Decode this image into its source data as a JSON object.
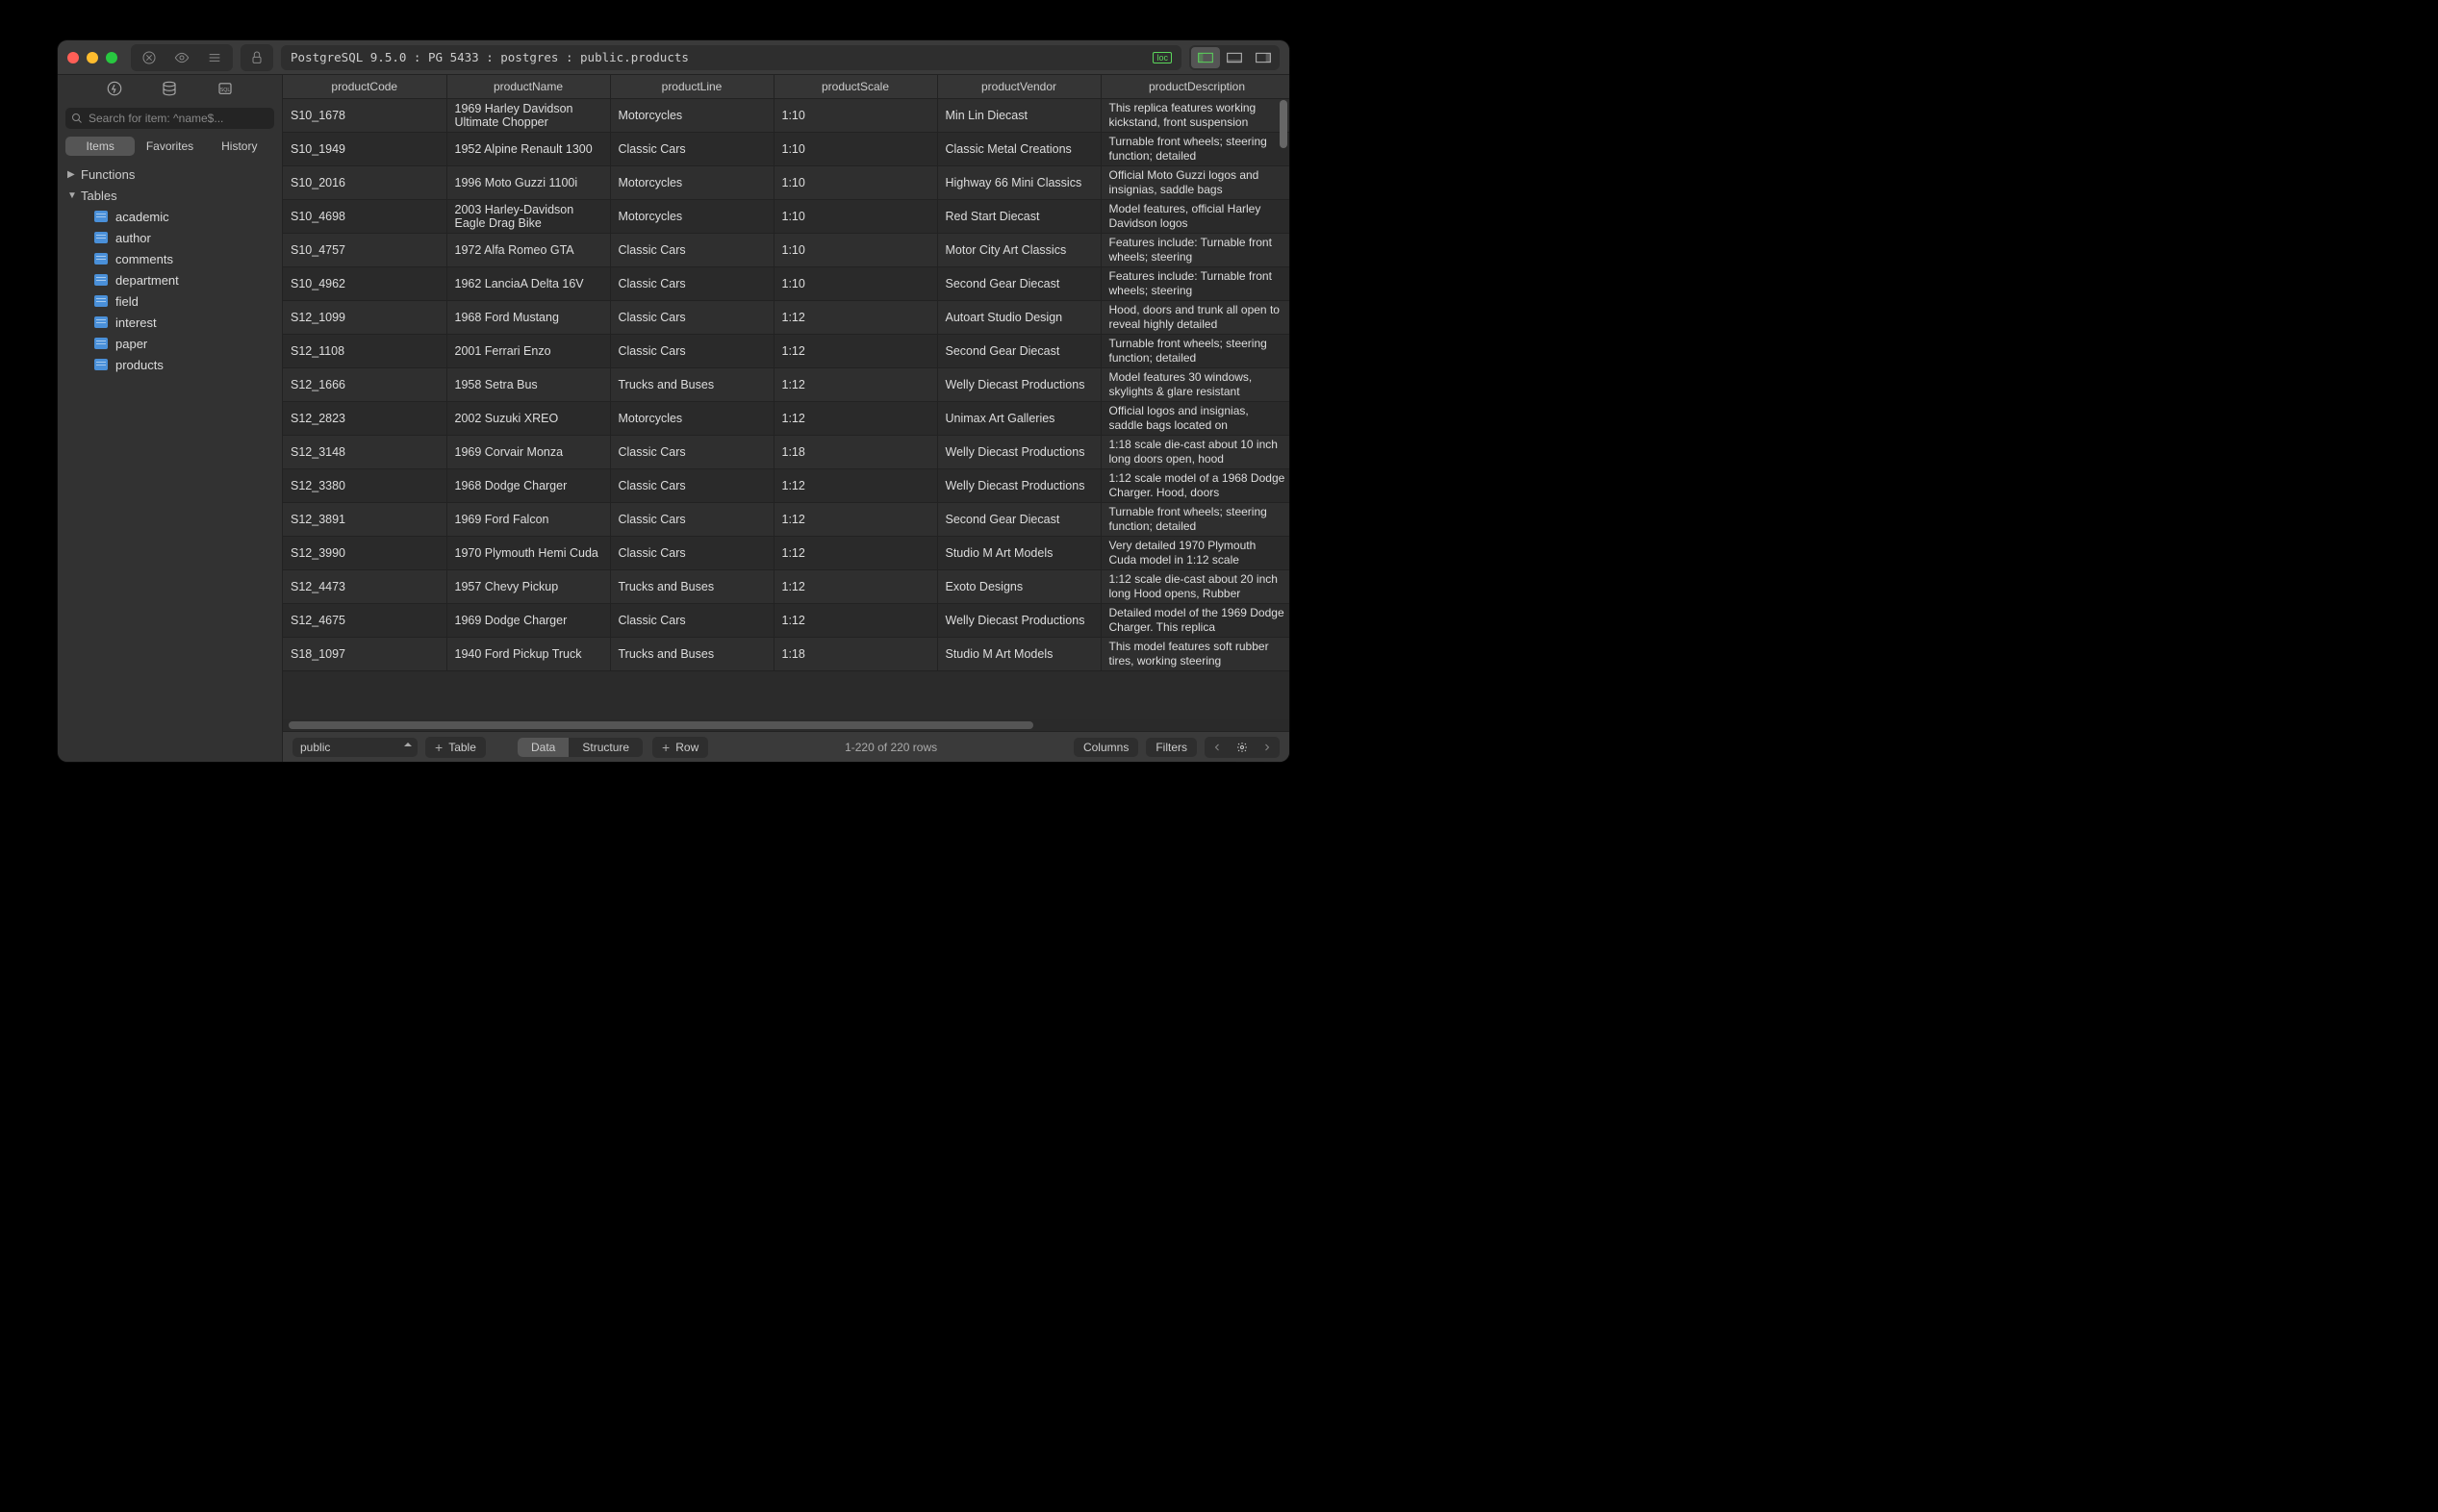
{
  "titlebar": {
    "path": "PostgreSQL 9.5.0 : PG 5433 : postgres : public.products",
    "loc_badge": "loc"
  },
  "sidebar": {
    "search_placeholder": "Search for item: ^name$...",
    "tabs": {
      "items": "Items",
      "favorites": "Favorites",
      "history": "History"
    },
    "sections": {
      "functions": "Functions",
      "tables": "Tables"
    },
    "tables": [
      "academic",
      "author",
      "comments",
      "department",
      "field",
      "interest",
      "paper",
      "products"
    ]
  },
  "columns": [
    "productCode",
    "productName",
    "productLine",
    "productScale",
    "productVendor",
    "productDescription"
  ],
  "rows": [
    {
      "code": "S10_1678",
      "name": "1969 Harley Davidson Ultimate Chopper",
      "line": "Motorcycles",
      "scale": "1:10",
      "vendor": "Min Lin Diecast",
      "desc": "This replica features working kickstand, front suspension"
    },
    {
      "code": "S10_1949",
      "name": "1952 Alpine Renault 1300",
      "line": "Classic Cars",
      "scale": "1:10",
      "vendor": "Classic Metal Creations",
      "desc": "Turnable front wheels; steering function; detailed"
    },
    {
      "code": "S10_2016",
      "name": "1996 Moto Guzzi 1100i",
      "line": "Motorcycles",
      "scale": "1:10",
      "vendor": "Highway 66 Mini Classics",
      "desc": "Official Moto Guzzi logos and insignias, saddle bags"
    },
    {
      "code": "S10_4698",
      "name": "2003 Harley-Davidson Eagle Drag Bike",
      "line": "Motorcycles",
      "scale": "1:10",
      "vendor": "Red Start Diecast",
      "desc": "Model features, official Harley Davidson logos"
    },
    {
      "code": "S10_4757",
      "name": "1972 Alfa Romeo GTA",
      "line": "Classic Cars",
      "scale": "1:10",
      "vendor": "Motor City Art Classics",
      "desc": "Features include: Turnable front wheels; steering"
    },
    {
      "code": "S10_4962",
      "name": "1962 LanciaA Delta 16V",
      "line": "Classic Cars",
      "scale": "1:10",
      "vendor": "Second Gear Diecast",
      "desc": "Features include: Turnable front wheels; steering"
    },
    {
      "code": "S12_1099",
      "name": "1968 Ford Mustang",
      "line": "Classic Cars",
      "scale": "1:12",
      "vendor": "Autoart Studio Design",
      "desc": "Hood, doors and trunk all open to reveal highly detailed"
    },
    {
      "code": "S12_1108",
      "name": "2001 Ferrari Enzo",
      "line": "Classic Cars",
      "scale": "1:12",
      "vendor": "Second Gear Diecast",
      "desc": "Turnable front wheels; steering function; detailed"
    },
    {
      "code": "S12_1666",
      "name": "1958 Setra Bus",
      "line": "Trucks and Buses",
      "scale": "1:12",
      "vendor": "Welly Diecast Productions",
      "desc": "Model features 30 windows, skylights & glare resistant"
    },
    {
      "code": "S12_2823",
      "name": "2002 Suzuki XREO",
      "line": "Motorcycles",
      "scale": "1:12",
      "vendor": "Unimax Art Galleries",
      "desc": "Official logos and insignias, saddle bags located on"
    },
    {
      "code": "S12_3148",
      "name": "1969 Corvair Monza",
      "line": "Classic Cars",
      "scale": "1:18",
      "vendor": "Welly Diecast Productions",
      "desc": "1:18 scale die-cast about 10 inch long doors open, hood"
    },
    {
      "code": "S12_3380",
      "name": "1968 Dodge Charger",
      "line": "Classic Cars",
      "scale": "1:12",
      "vendor": "Welly Diecast Productions",
      "desc": "1:12 scale model of a 1968 Dodge Charger. Hood, doors"
    },
    {
      "code": "S12_3891",
      "name": "1969 Ford Falcon",
      "line": "Classic Cars",
      "scale": "1:12",
      "vendor": "Second Gear Diecast",
      "desc": "Turnable front wheels; steering function; detailed"
    },
    {
      "code": "S12_3990",
      "name": "1970 Plymouth Hemi Cuda",
      "line": "Classic Cars",
      "scale": "1:12",
      "vendor": "Studio M Art Models",
      "desc": "Very detailed 1970 Plymouth Cuda model in 1:12 scale"
    },
    {
      "code": "S12_4473",
      "name": "1957 Chevy Pickup",
      "line": "Trucks and Buses",
      "scale": "1:12",
      "vendor": "Exoto Designs",
      "desc": "1:12 scale die-cast about 20 inch long Hood opens, Rubber"
    },
    {
      "code": "S12_4675",
      "name": "1969 Dodge Charger",
      "line": "Classic Cars",
      "scale": "1:12",
      "vendor": "Welly Diecast Productions",
      "desc": "Detailed model of the 1969 Dodge Charger. This replica"
    },
    {
      "code": "S18_1097",
      "name": "1940 Ford Pickup Truck",
      "line": "Trucks and Buses",
      "scale": "1:18",
      "vendor": "Studio M Art Models",
      "desc": "This model features soft rubber tires, working steering"
    }
  ],
  "bottombar": {
    "schema": "public",
    "add_table": "Table",
    "seg_data": "Data",
    "seg_structure": "Structure",
    "add_row": "Row",
    "status": "1-220 of 220 rows",
    "columns_btn": "Columns",
    "filters_btn": "Filters"
  }
}
